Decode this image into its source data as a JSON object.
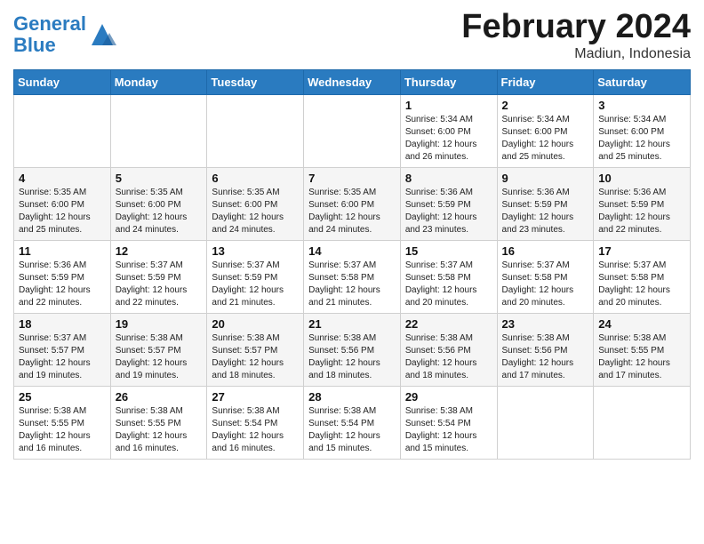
{
  "header": {
    "logo_line1": "General",
    "logo_line2": "Blue",
    "month_title": "February 2024",
    "location": "Madiun, Indonesia"
  },
  "days_of_week": [
    "Sunday",
    "Monday",
    "Tuesday",
    "Wednesday",
    "Thursday",
    "Friday",
    "Saturday"
  ],
  "weeks": [
    [
      {
        "day": "",
        "info": ""
      },
      {
        "day": "",
        "info": ""
      },
      {
        "day": "",
        "info": ""
      },
      {
        "day": "",
        "info": ""
      },
      {
        "day": "1",
        "info": "Sunrise: 5:34 AM\nSunset: 6:00 PM\nDaylight: 12 hours\nand 26 minutes."
      },
      {
        "day": "2",
        "info": "Sunrise: 5:34 AM\nSunset: 6:00 PM\nDaylight: 12 hours\nand 25 minutes."
      },
      {
        "day": "3",
        "info": "Sunrise: 5:34 AM\nSunset: 6:00 PM\nDaylight: 12 hours\nand 25 minutes."
      }
    ],
    [
      {
        "day": "4",
        "info": "Sunrise: 5:35 AM\nSunset: 6:00 PM\nDaylight: 12 hours\nand 25 minutes."
      },
      {
        "day": "5",
        "info": "Sunrise: 5:35 AM\nSunset: 6:00 PM\nDaylight: 12 hours\nand 24 minutes."
      },
      {
        "day": "6",
        "info": "Sunrise: 5:35 AM\nSunset: 6:00 PM\nDaylight: 12 hours\nand 24 minutes."
      },
      {
        "day": "7",
        "info": "Sunrise: 5:35 AM\nSunset: 6:00 PM\nDaylight: 12 hours\nand 24 minutes."
      },
      {
        "day": "8",
        "info": "Sunrise: 5:36 AM\nSunset: 5:59 PM\nDaylight: 12 hours\nand 23 minutes."
      },
      {
        "day": "9",
        "info": "Sunrise: 5:36 AM\nSunset: 5:59 PM\nDaylight: 12 hours\nand 23 minutes."
      },
      {
        "day": "10",
        "info": "Sunrise: 5:36 AM\nSunset: 5:59 PM\nDaylight: 12 hours\nand 22 minutes."
      }
    ],
    [
      {
        "day": "11",
        "info": "Sunrise: 5:36 AM\nSunset: 5:59 PM\nDaylight: 12 hours\nand 22 minutes."
      },
      {
        "day": "12",
        "info": "Sunrise: 5:37 AM\nSunset: 5:59 PM\nDaylight: 12 hours\nand 22 minutes."
      },
      {
        "day": "13",
        "info": "Sunrise: 5:37 AM\nSunset: 5:59 PM\nDaylight: 12 hours\nand 21 minutes."
      },
      {
        "day": "14",
        "info": "Sunrise: 5:37 AM\nSunset: 5:58 PM\nDaylight: 12 hours\nand 21 minutes."
      },
      {
        "day": "15",
        "info": "Sunrise: 5:37 AM\nSunset: 5:58 PM\nDaylight: 12 hours\nand 20 minutes."
      },
      {
        "day": "16",
        "info": "Sunrise: 5:37 AM\nSunset: 5:58 PM\nDaylight: 12 hours\nand 20 minutes."
      },
      {
        "day": "17",
        "info": "Sunrise: 5:37 AM\nSunset: 5:58 PM\nDaylight: 12 hours\nand 20 minutes."
      }
    ],
    [
      {
        "day": "18",
        "info": "Sunrise: 5:37 AM\nSunset: 5:57 PM\nDaylight: 12 hours\nand 19 minutes."
      },
      {
        "day": "19",
        "info": "Sunrise: 5:38 AM\nSunset: 5:57 PM\nDaylight: 12 hours\nand 19 minutes."
      },
      {
        "day": "20",
        "info": "Sunrise: 5:38 AM\nSunset: 5:57 PM\nDaylight: 12 hours\nand 18 minutes."
      },
      {
        "day": "21",
        "info": "Sunrise: 5:38 AM\nSunset: 5:56 PM\nDaylight: 12 hours\nand 18 minutes."
      },
      {
        "day": "22",
        "info": "Sunrise: 5:38 AM\nSunset: 5:56 PM\nDaylight: 12 hours\nand 18 minutes."
      },
      {
        "day": "23",
        "info": "Sunrise: 5:38 AM\nSunset: 5:56 PM\nDaylight: 12 hours\nand 17 minutes."
      },
      {
        "day": "24",
        "info": "Sunrise: 5:38 AM\nSunset: 5:55 PM\nDaylight: 12 hours\nand 17 minutes."
      }
    ],
    [
      {
        "day": "25",
        "info": "Sunrise: 5:38 AM\nSunset: 5:55 PM\nDaylight: 12 hours\nand 16 minutes."
      },
      {
        "day": "26",
        "info": "Sunrise: 5:38 AM\nSunset: 5:55 PM\nDaylight: 12 hours\nand 16 minutes."
      },
      {
        "day": "27",
        "info": "Sunrise: 5:38 AM\nSunset: 5:54 PM\nDaylight: 12 hours\nand 16 minutes."
      },
      {
        "day": "28",
        "info": "Sunrise: 5:38 AM\nSunset: 5:54 PM\nDaylight: 12 hours\nand 15 minutes."
      },
      {
        "day": "29",
        "info": "Sunrise: 5:38 AM\nSunset: 5:54 PM\nDaylight: 12 hours\nand 15 minutes."
      },
      {
        "day": "",
        "info": ""
      },
      {
        "day": "",
        "info": ""
      }
    ]
  ]
}
